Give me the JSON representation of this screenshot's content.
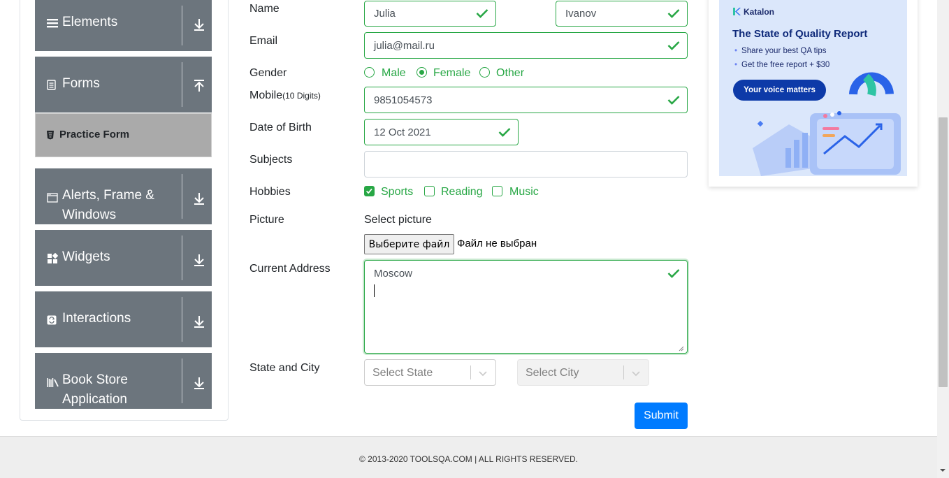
{
  "sidebar": {
    "groups": [
      {
        "label": "Elements",
        "icon": "hamburger-icon",
        "arrow": "down-arrow-icon"
      },
      {
        "label": "Forms",
        "icon": "document-icon",
        "arrow": "up-arrow-icon"
      },
      {
        "label": "Alerts, Frame &",
        "label2": "Windows",
        "icon": "window-icon",
        "arrow": "down-arrow-icon"
      },
      {
        "label": "Widgets",
        "icon": "widgets-icon",
        "arrow": "down-arrow-icon"
      },
      {
        "label": "Interactions",
        "icon": "interactions-icon",
        "arrow": "down-arrow-icon"
      },
      {
        "label": "Book Store",
        "label2": "Application",
        "icon": "books-icon",
        "arrow": "down-arrow-icon"
      }
    ],
    "active_item": "Practice Form",
    "colors": {
      "group_bg": "#6c757d",
      "active_bg": "#aaaaaa"
    }
  },
  "form": {
    "name_label": "Name",
    "first_name": "Julia",
    "last_name": "Ivanov",
    "email_label": "Email",
    "email": "julia@mail.ru",
    "gender_label": "Gender",
    "gender_options": [
      "Male",
      "Female",
      "Other"
    ],
    "gender_selected": "Female",
    "mobile_label": "Mobile",
    "mobile_hint": "(10 Digits)",
    "mobile": "9851054573",
    "dob_label": "Date of Birth",
    "dob": "12 Oct 2021",
    "subjects_label": "Subjects",
    "hobbies_label": "Hobbies",
    "hobbies": [
      {
        "label": "Sports",
        "checked": true
      },
      {
        "label": "Reading",
        "checked": false
      },
      {
        "label": "Music",
        "checked": false
      }
    ],
    "picture_label": "Picture",
    "picture_prompt": "Select picture",
    "file_button": "Выберите файл",
    "file_status": "Файл не выбран",
    "address_label": "Current Address",
    "address": "Moscow",
    "state_city_label": "State and City",
    "state_placeholder": "Select State",
    "city_placeholder": "Select City",
    "submit_label": "Submit",
    "colors": {
      "valid": "#28a745",
      "primary": "#007bff"
    }
  },
  "ad": {
    "brand": "Katalon",
    "heading": "The State of Quality Report",
    "bullets": [
      "Share your best QA tips",
      "Get the free report + $30"
    ],
    "cta": "Your voice matters",
    "colors": {
      "bg": "#dbe7fb",
      "cta": "#0d3aa8"
    }
  },
  "footer": {
    "text": "© 2013-2020 TOOLSQA.COM | ALL RIGHTS RESERVED."
  }
}
